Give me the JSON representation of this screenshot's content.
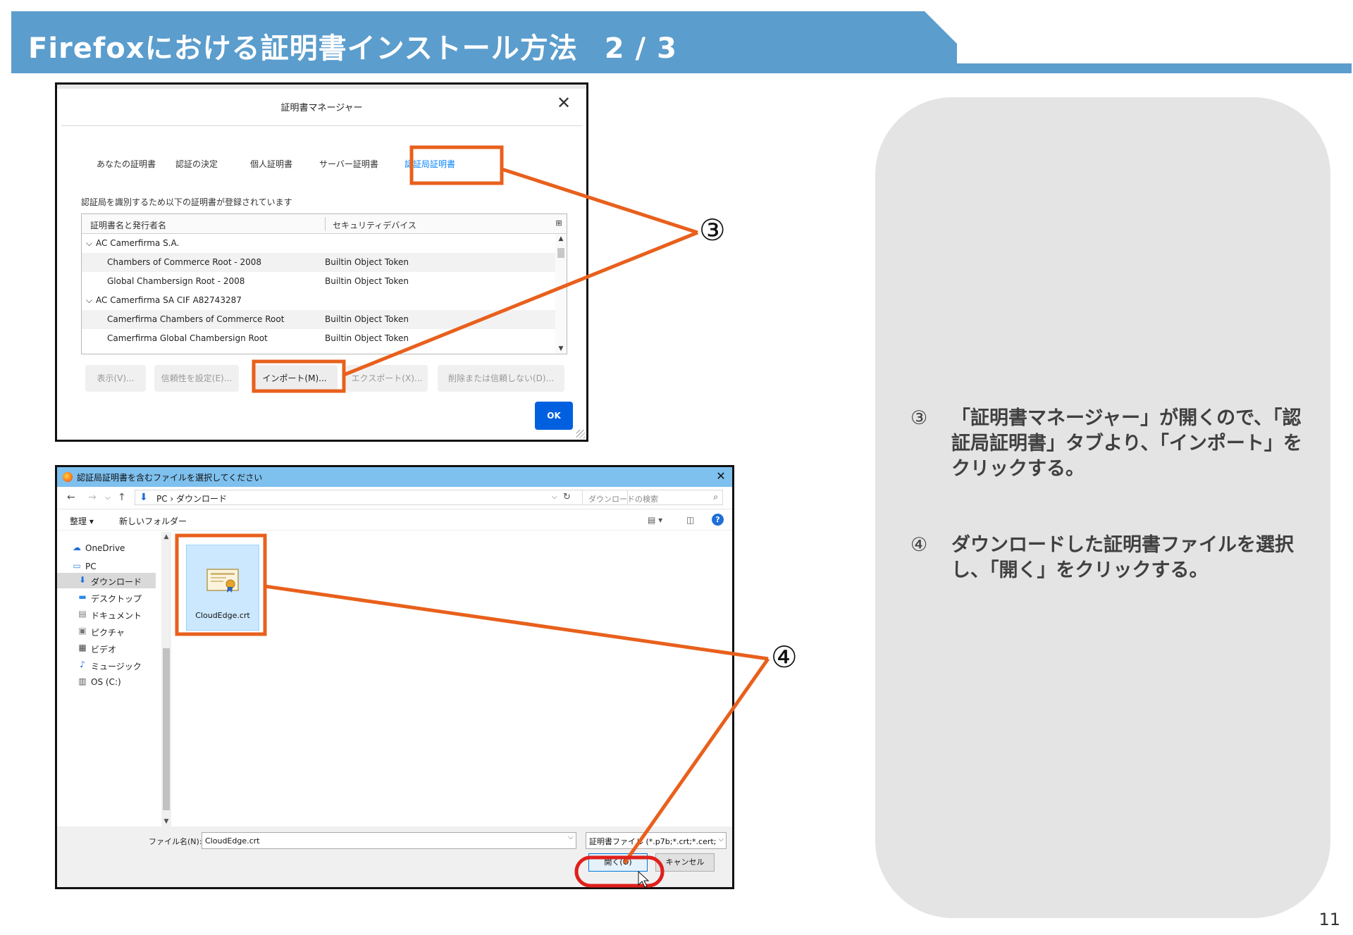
{
  "header": {
    "title": "Firefoxにおける証明書インストール方法",
    "page_indicator": "2 / 3",
    "banner_color": "#5b9dcd"
  },
  "cert_manager": {
    "title": "証明書マネージャー",
    "tabs": [
      {
        "label": "あなたの証明書",
        "active": false
      },
      {
        "label": "認証の決定",
        "active": false
      },
      {
        "label": "個人証明書",
        "active": false
      },
      {
        "label": "サーバー証明書",
        "active": false
      },
      {
        "label": "認証局証明書",
        "active": true
      }
    ],
    "description": "認証局を識別するため以下の証明書が登録されています",
    "columns": [
      "証明書名と発行者名",
      "セキュリティデバイス"
    ],
    "rows": [
      {
        "name": "AC Camerfirma S.A.",
        "token": "",
        "group": true
      },
      {
        "name": "Chambers of Commerce Root - 2008",
        "token": "Builtin Object Token",
        "group": false
      },
      {
        "name": "Global Chambersign Root - 2008",
        "token": "Builtin Object Token",
        "group": false
      },
      {
        "name": "AC Camerfirma SA CIF A82743287",
        "token": "",
        "group": true
      },
      {
        "name": "Camerfirma Chambers of Commerce Root",
        "token": "Builtin Object Token",
        "group": false
      },
      {
        "name": "Camerfirma Global Chambersign Root",
        "token": "Builtin Object Token",
        "group": false
      }
    ],
    "buttons": {
      "view": "表示(V)...",
      "trust": "信頼性を設定(E)...",
      "import": "インポート(M)...",
      "export": "エクスポート(X)...",
      "delete": "削除または信頼しない(D)..."
    },
    "ok": "OK"
  },
  "file_dialog": {
    "title": "認証局証明書を含むファイルを選択してください",
    "breadcrumb": "PC › ダウンロード",
    "search_placeholder": "ダウンロードの検索",
    "organize": "整理 ▾",
    "new_folder": "新しいフォルダー",
    "nav_items": [
      {
        "label": "OneDrive",
        "icon": "cloud-icon"
      },
      {
        "label": "PC",
        "icon": "computer-icon"
      },
      {
        "label": "ダウンロード",
        "icon": "download-arrow-icon",
        "selected": true
      },
      {
        "label": "デスクトップ",
        "icon": "desktop-icon"
      },
      {
        "label": "ドキュメント",
        "icon": "document-icon"
      },
      {
        "label": "ピクチャ",
        "icon": "picture-icon"
      },
      {
        "label": "ビデオ",
        "icon": "video-icon"
      },
      {
        "label": "ミュージック",
        "icon": "music-icon"
      },
      {
        "label": "OS (C:)",
        "icon": "drive-icon"
      }
    ],
    "file": {
      "name": "CloudEdge.crt"
    },
    "filename_label": "ファイル名(N):",
    "filename_value": "CloudEdge.crt",
    "filter": "証明書ファイル (*.p7b;*.crt;*.cert;",
    "open": "開く(O)",
    "cancel": "キャンセル"
  },
  "callouts": {
    "step3_marker": "③",
    "step4_marker": "④",
    "highlight_color": "#e8601c",
    "open_highlight_color": "#e0201c"
  },
  "instructions": [
    {
      "marker": "③",
      "text": "「証明書マネージャー」が開くので、「認証局証明書」タブより、「インポート」をクリックする。"
    },
    {
      "marker": "④",
      "text": "ダウンロードした証明書ファイルを選択し、「開く」をクリックする。"
    }
  ],
  "page_number": "11"
}
